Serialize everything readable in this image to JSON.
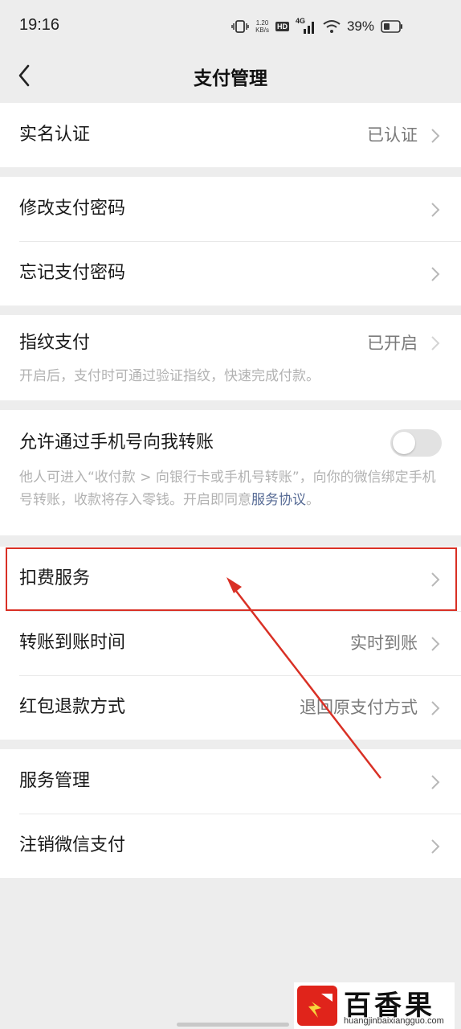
{
  "status_bar": {
    "time": "19:16",
    "net_speed_value": "1.20",
    "net_speed_unit": "KB/s",
    "hd_badge": "HD",
    "network": "4G",
    "battery_percent": "39%",
    "icons": [
      "vibrate-icon",
      "hd-icon",
      "signal-icon",
      "wifi-icon",
      "battery-icon"
    ]
  },
  "nav": {
    "title": "支付管理",
    "back_icon": "chevron-left-icon"
  },
  "groups": {
    "identity": {
      "label": "实名认证",
      "value": "已认证"
    },
    "password": {
      "change_label": "修改支付密码",
      "forgot_label": "忘记支付密码"
    },
    "fingerprint": {
      "label": "指纹支付",
      "value": "已开启",
      "description": "开启后，支付时可通过验证指纹，快速完成付款。"
    },
    "phone_transfer": {
      "label": "允许通过手机号向我转账",
      "enabled": false,
      "description": "他人可进入“收付款 > 向银行卡或手机号转账”，向你的微信绑定手机号转账，收款将存入零钱。开启即同意",
      "link_text": "服务协议",
      "description_end": "。"
    },
    "services": {
      "deduction_label": "扣费服务",
      "arrival_label": "转账到账时间",
      "arrival_value": "实时到账",
      "refund_label": "红包退款方式",
      "refund_value": "退回原支付方式"
    },
    "manage": {
      "service_manage_label": "服务管理",
      "cancel_label": "注销微信支付"
    }
  },
  "annotation": {
    "color": "#d93025"
  },
  "watermark": {
    "title": "百香果号",
    "url": "huangjinbaixiangguo.com"
  },
  "colors": {
    "background": "#ededed",
    "link": "#576b95",
    "secondary_text": "#7a7a7a"
  }
}
